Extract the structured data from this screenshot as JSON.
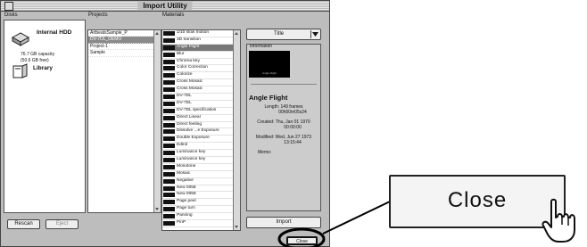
{
  "window": {
    "title": "Import Utility"
  },
  "columns": {
    "disks": "Disks",
    "projects": "Projects",
    "materials": "Materials"
  },
  "disks": [
    {
      "name": "Internal HDD",
      "capacity": "76.7 GB capacity",
      "free": "(50.6 GB free)"
    },
    {
      "name": "Library"
    }
  ],
  "projects": [
    "ArtbeatsSample_P",
    "DV-7DL_DEMO",
    "Project-1",
    "Sample"
  ],
  "materials": [
    "1/10 slow motion",
    "3D transition",
    "Angle Flight",
    "Blur",
    "Chroma key",
    "Color Correction",
    "Colorize",
    "Cross Mosaic",
    "Cross Mosaic",
    "DV-7DL",
    "DV-7DL",
    "DV-7DL specification",
    "Direct Linear",
    "Direct feeling",
    "Dissolve ...e Exposure",
    "Double Exposure",
    "Edirol",
    "Luminance key",
    "Luminance key",
    "Monotone",
    "Mosaic",
    "Negative",
    "New 0058",
    "New 0059",
    "Page peel",
    "Page turn",
    "Panning",
    "PinP"
  ],
  "selected_material": 2,
  "selected_project": 1,
  "sort": {
    "value": "Title"
  },
  "info": {
    "header": "Information",
    "thumb_caption": "Angle Flight",
    "title": "Angle Flight",
    "length_label": "Length:",
    "length_value": "149 frames",
    "length_tc": "00h00m05s24",
    "created_label": "Created:",
    "created_value": "Thu, Jan 01 1970",
    "created_time": "00:00:00",
    "modified_label": "Modified:",
    "modified_value": "Wed, Jun 27 1973",
    "modified_time": "13:15:44",
    "memo_label": "Memo:"
  },
  "buttons": {
    "rescan": "Rescan",
    "eject": "Eject",
    "import": "Import",
    "close": "Close"
  },
  "callout": {
    "label": "Close"
  }
}
